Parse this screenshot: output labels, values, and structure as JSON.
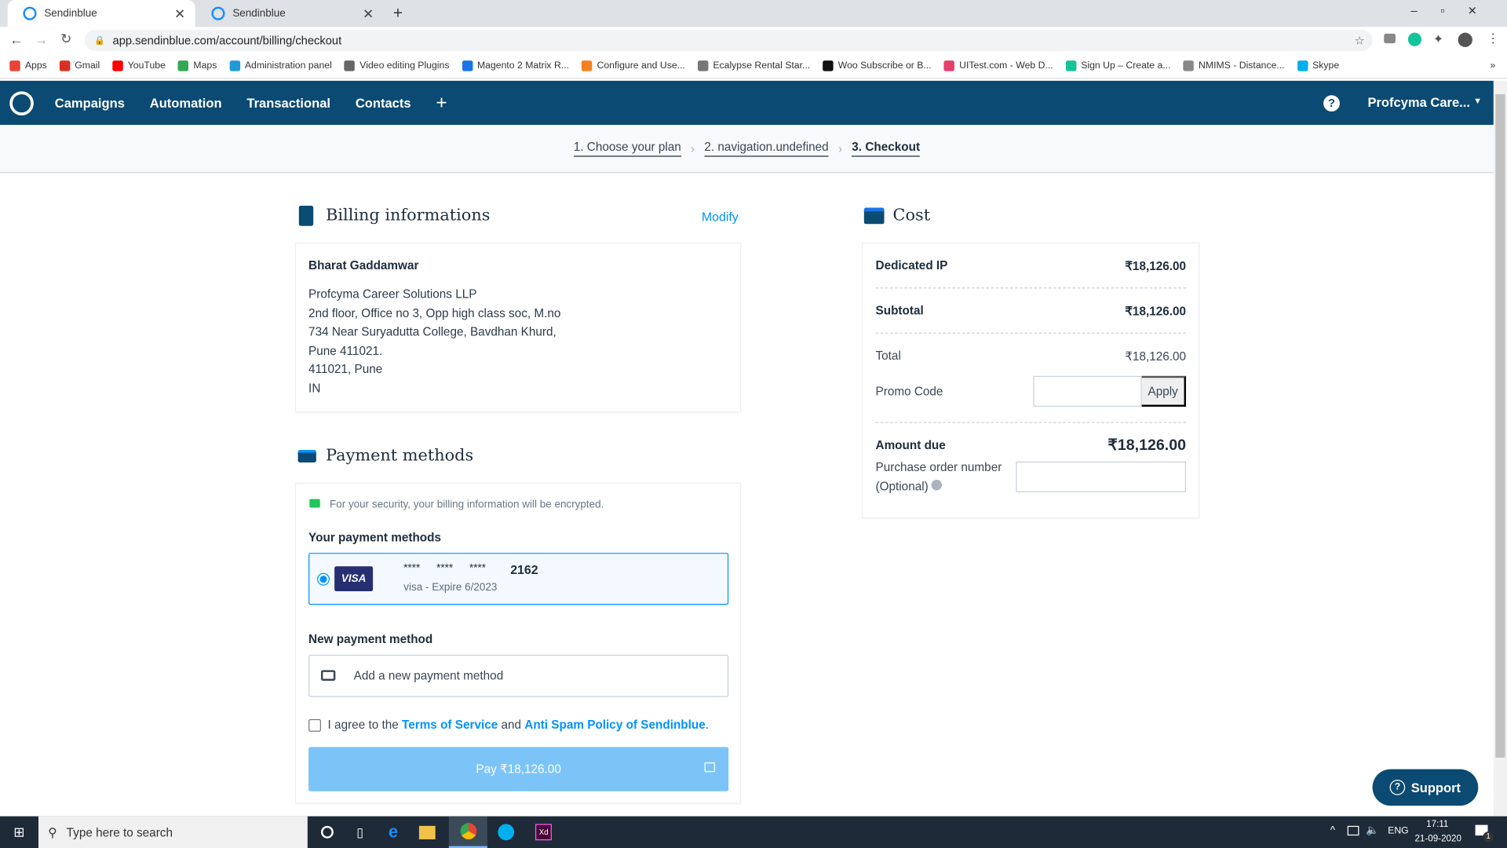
{
  "browser": {
    "tabs": [
      {
        "label": "Sendinblue",
        "active": true
      },
      {
        "label": "Sendinblue",
        "active": false
      }
    ],
    "url": "app.sendinblue.com/account/billing/checkout",
    "bookmarks": [
      {
        "label": "Apps",
        "color": "#ea4335"
      },
      {
        "label": "Gmail",
        "color": "#d93025"
      },
      {
        "label": "YouTube",
        "color": "#ff0000"
      },
      {
        "label": "Maps",
        "color": "#34a853"
      },
      {
        "label": "Administration panel",
        "color": "#1e9bd7"
      },
      {
        "label": "Video editing Plugins",
        "color": "#666666"
      },
      {
        "label": "Magento 2 Matrix R...",
        "color": "#1a73e8"
      },
      {
        "label": "Configure and Use...",
        "color": "#f4811f"
      },
      {
        "label": "Ecalypse Rental Star...",
        "color": "#777777"
      },
      {
        "label": "Woo Subscribe or B...",
        "color": "#111111"
      },
      {
        "label": "UITest.com - Web D...",
        "color": "#e83e6c"
      },
      {
        "label": "Sign Up – Create a...",
        "color": "#15c39a"
      },
      {
        "label": "NMIMS - Distance...",
        "color": "#888888"
      },
      {
        "label": "Skype",
        "color": "#00aff0"
      }
    ]
  },
  "nav": {
    "items": [
      "Campaigns",
      "Automation",
      "Transactional",
      "Contacts"
    ],
    "plus": "+",
    "account": "Profcyma Care...",
    "color": "#0b4a72"
  },
  "steps": [
    "1. Choose your plan",
    "2. navigation.undefined",
    "3. Checkout"
  ],
  "billing": {
    "title": "Billing informations",
    "modify": "Modify",
    "name": "Bharat Gaddamwar",
    "lines": [
      "Profcyma Career Solutions LLP",
      "2nd floor, Office no 3, Opp high class soc, M.no",
      "734 Near Suryadutta College, Bavdhan Khurd,",
      "Pune 411021.",
      "411021, Pune",
      "IN"
    ]
  },
  "payment": {
    "title": "Payment methods",
    "security": "For your security, your billing information will be encrypted.",
    "your_methods": "Your payment methods",
    "card": {
      "brand": "VISA",
      "masked": [
        "****",
        "****",
        "****"
      ],
      "last4": "2162",
      "detail": "visa - Expire 6/2023",
      "selected": true
    },
    "new_method_label": "New payment method",
    "add_new": "Add a new payment method",
    "agree": {
      "prefix": "I agree to the ",
      "tos": "Terms of Service",
      "and": " and ",
      "policy": "Anti Spam Policy of Sendinblue",
      "suffix": ".",
      "checked": false
    },
    "pay_button": "Pay ₹18,126.00"
  },
  "cost": {
    "title": "Cost",
    "dedicated_ip": {
      "label": "Dedicated IP",
      "value": "₹18,126.00"
    },
    "subtotal": {
      "label": "Subtotal",
      "value": "₹18,126.00"
    },
    "total": {
      "label": "Total",
      "value": "₹18,126.00"
    },
    "promo": {
      "label": "Promo Code",
      "value": "",
      "apply": "Apply"
    },
    "amount_due": {
      "label": "Amount due",
      "value": "₹18,126.00"
    },
    "po": {
      "label1": "Purchase order number",
      "label2": "(Optional)",
      "value": ""
    }
  },
  "support": "Support",
  "taskbar": {
    "search_placeholder": "Type here to search",
    "lang": "ENG",
    "time": "17:11",
    "date": "21-09-2020",
    "notifications": "1"
  }
}
